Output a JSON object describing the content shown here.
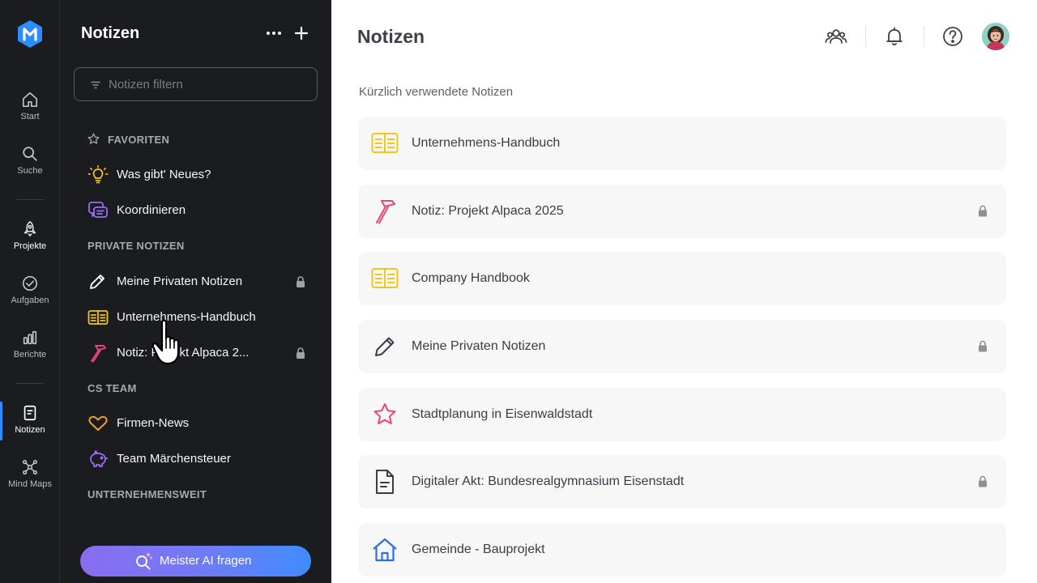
{
  "rail": {
    "items": [
      {
        "label": "Start",
        "icon": "home-icon"
      },
      {
        "label": "Suche",
        "icon": "search-icon"
      },
      {
        "label": "Projekte",
        "icon": "rocket-icon"
      },
      {
        "label": "Aufgaben",
        "icon": "check-circle-icon"
      },
      {
        "label": "Berichte",
        "icon": "bar-chart-icon"
      },
      {
        "label": "Notizen",
        "icon": "note-icon",
        "active": true
      },
      {
        "label": "Mind Maps",
        "icon": "mindmap-icon"
      }
    ]
  },
  "sidebar": {
    "title": "Notizen",
    "filter_placeholder": "Notizen filtern",
    "sections": {
      "favorites": "FAVORITEN",
      "private": "PRIVATE NOTIZEN",
      "cs_team": "CS TEAM",
      "company": "UNTERNEHMENSWEIT"
    },
    "favorites": [
      {
        "label": "Was gibt' Neues?",
        "icon": "lightbulb-icon"
      },
      {
        "label": "Koordinieren",
        "icon": "chat-bubbles-icon"
      }
    ],
    "private": [
      {
        "label": "Meine Privaten Notizen",
        "icon": "pencil-icon",
        "locked": true
      },
      {
        "label": "Unternehmens-Handbuch",
        "icon": "book-icon",
        "locked": false
      },
      {
        "label": "Notiz: Projekt Alpaca 2...",
        "icon": "hammer-icon",
        "locked": true
      }
    ],
    "cs_team": [
      {
        "label": "Firmen-News",
        "icon": "heart-icon"
      },
      {
        "label": "Team Märchensteuer",
        "icon": "piggy-bank-icon"
      }
    ],
    "ai_button": "Meister AI fragen"
  },
  "main": {
    "title": "Notizen",
    "recent_heading": "Kürzlich verwendete Notizen",
    "cards": [
      {
        "label": "Unternehmens-Handbuch",
        "icon": "book-icon",
        "locked": false
      },
      {
        "label": "Notiz: Projekt Alpaca 2025",
        "icon": "hammer-icon",
        "locked": true
      },
      {
        "label": "Company Handbook",
        "icon": "book-icon",
        "locked": false
      },
      {
        "label": "Meine Privaten Notizen",
        "icon": "pencil-icon",
        "locked": true
      },
      {
        "label": "Stadtplanung in Eisenwaldstadt",
        "icon": "star-icon",
        "locked": false
      },
      {
        "label": "Digitaler Akt: Bundesrealgymnasium Eisenstadt",
        "icon": "document-icon",
        "locked": true
      },
      {
        "label": "Gemeinde - Bauprojekt",
        "icon": "house-icon",
        "locked": false
      }
    ]
  },
  "colors": {
    "rail_bg": "#1b1c1f",
    "accent_blue": "#2d8cff",
    "book_yellow": "#f5c518",
    "hammer_pink": "#e8457a",
    "star_pink": "#e8457a",
    "house_blue": "#2f6fe0",
    "heart_orange": "#f5a623",
    "purple": "#9b6cf0"
  }
}
